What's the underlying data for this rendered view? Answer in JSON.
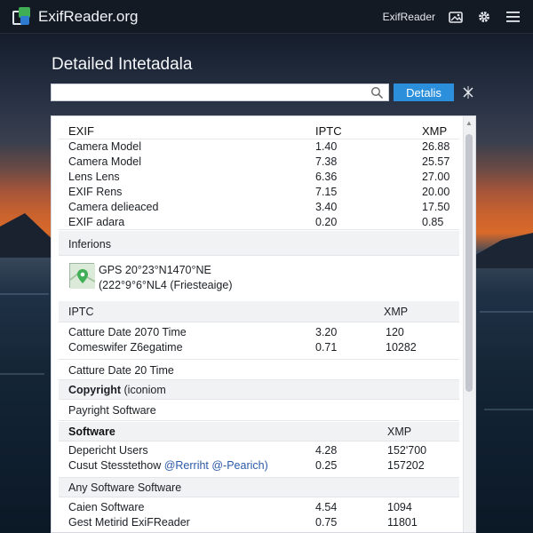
{
  "app": {
    "brand": "ExifReader.org",
    "nav_link": "ExifReader",
    "accent": "#2c8fdb"
  },
  "page": {
    "title": "Detailed Intetadala"
  },
  "search": {
    "value": "",
    "placeholder": "",
    "button_label": "Detalis"
  },
  "icons": {
    "logo": "logo-icon",
    "nav_image": "image-icon",
    "nav_settings": "gear-icon",
    "nav_menu": "hamburger-icon",
    "search": "search-icon",
    "clear": "sparkle-close-icon",
    "map": "map-pin-icon"
  },
  "sections": {
    "exif": {
      "headers": [
        "EXIF",
        "IPTC",
        "XMP"
      ],
      "rows": [
        [
          "Camera Model",
          "1.40",
          "26.88"
        ],
        [
          "Camera Model",
          "7.38",
          "25.57"
        ],
        [
          "Lens Lens",
          "6.36",
          "27.00"
        ],
        [
          "EXIF Rens",
          "7.15",
          "20.00"
        ],
        [
          "Camera delieaced",
          "3.40",
          "17.50"
        ],
        [
          "EXIF adara",
          "0.20",
          "0.85"
        ]
      ]
    },
    "inferions": {
      "title": "Inferions",
      "gps_line1": "GPS 20°23°N1470°NE",
      "gps_line2": "(222°9°6°NL4 (Friesteaige)"
    },
    "iptc": {
      "headers": [
        "IPTC",
        "XMP"
      ],
      "rows": [
        [
          "Catture Date 2070 Time",
          "3.20",
          "120"
        ],
        [
          "Comeswifer Z6egatime",
          "0.71",
          "10282"
        ]
      ],
      "single": "Catture Date 20 Time",
      "copyright_label": "Copyright",
      "copyright_suffix": "(iconiom",
      "payright": "Payright Software"
    },
    "software": {
      "headers": [
        "Software",
        "XMP"
      ],
      "rows": [
        [
          "Depericht Users",
          "4.28",
          "152ʹ700"
        ],
        [
          "Cusut Stesstethow",
          "0.25",
          "157202"
        ]
      ],
      "link_text": "@Rerriht @-Pearich)",
      "any_label": "Any Software Software",
      "rows2": [
        [
          "Caien Software",
          "4.54",
          "1094"
        ],
        [
          "Gest Metirid ExiFReader",
          "0.75",
          "11801"
        ]
      ]
    }
  }
}
